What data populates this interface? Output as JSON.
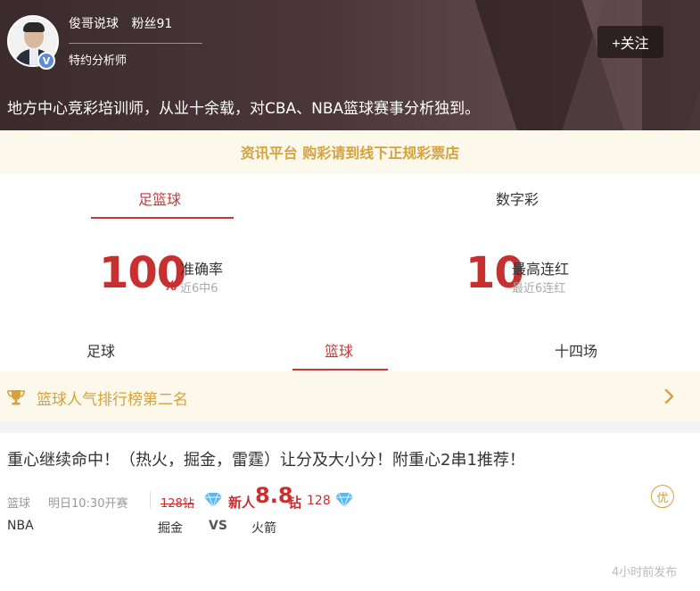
{
  "header": {
    "author_name": "俊哥说球",
    "fans": "粉丝91",
    "role": "特约分析师",
    "verified_mark": "V",
    "follow_label": "+关注",
    "intro": "地方中心竞彩培训师，从业十余载，对CBA、NBA篮球赛事分析独到。"
  },
  "notice": {
    "text": "资讯平台 购彩请到线下正规彩票店"
  },
  "stats": {
    "tabs": [
      {
        "label": "足篮球",
        "active": true
      },
      {
        "label": "数字彩",
        "active": false
      }
    ],
    "accuracy": {
      "value": "100",
      "unit": "%",
      "label": "准确率",
      "sub": "近6中6"
    },
    "streak": {
      "value": "10",
      "label": "最高连红",
      "sub": "最近6连红"
    }
  },
  "sport_tabs": [
    {
      "label": "足球",
      "active": false
    },
    {
      "label": "篮球",
      "active": true
    },
    {
      "label": "十四场",
      "active": false
    }
  ],
  "ranking": {
    "text": "篮球人气排行榜第二名",
    "icon": "trophy-icon"
  },
  "article": {
    "title": "重心继续命中！（热火，掘金，雷霆）让分及大小分！附重心2串1推荐！",
    "category": "篮球",
    "match_time": "明日10:30开赛",
    "old_price": "128钻",
    "new_user_label": "新人",
    "new_price": "8.8",
    "new_price_unit": "钻",
    "count": "128",
    "premium_badge": "优",
    "league": "NBA",
    "home_team": "掘金",
    "vs": "VS",
    "away_team": "火箭",
    "published": "4小时前发布"
  },
  "colors": {
    "accent_red": "#c7302f",
    "gold": "#d6a23b",
    "header_bg": "#3b2b2d"
  }
}
